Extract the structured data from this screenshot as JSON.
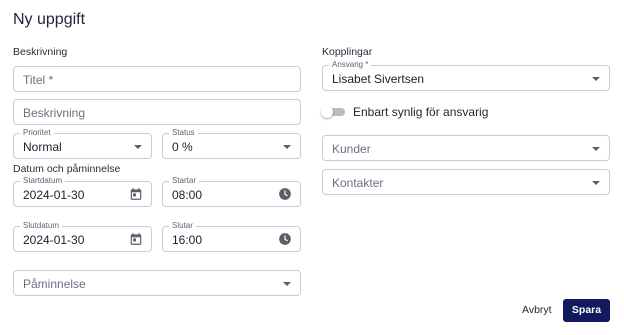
{
  "dialog": {
    "title": "Ny uppgift"
  },
  "left": {
    "description_heading": "Beskrivning",
    "title_field": {
      "placeholder": "Titel *"
    },
    "description_field": {
      "placeholder": "Beskrivning"
    },
    "priority": {
      "label": "Prioritet",
      "value": "Normal"
    },
    "status": {
      "label": "Status",
      "value": "0 %"
    },
    "date_heading": "Datum och påminnelse",
    "start_date": {
      "label": "Startdatum",
      "value": "2024-01-30"
    },
    "start_time": {
      "label": "Startar",
      "value": "08:00"
    },
    "end_date": {
      "label": "Slutdatum",
      "value": "2024-01-30"
    },
    "end_time": {
      "label": "Slutar",
      "value": "16:00"
    },
    "reminder": {
      "placeholder": "Påminnelse"
    }
  },
  "right": {
    "links_heading": "Kopplingar",
    "responsible": {
      "label": "Ansvarig *",
      "value": "Lisabet Sivertsen"
    },
    "private_toggle": {
      "label": "Enbart synlig för ansvarig",
      "checked": false
    },
    "customers": {
      "placeholder": "Kunder"
    },
    "contacts": {
      "placeholder": "Kontakter"
    }
  },
  "actions": {
    "cancel_label": "Avbryt",
    "save_label": "Spara"
  },
  "colors": {
    "primary": "#13195e",
    "border": "#c9ccd3",
    "icon": "#5a5f6c"
  },
  "icons": {
    "date_picker": "calendar-icon",
    "time_picker": "clock-icon",
    "dropdown": "caret-down-icon"
  }
}
